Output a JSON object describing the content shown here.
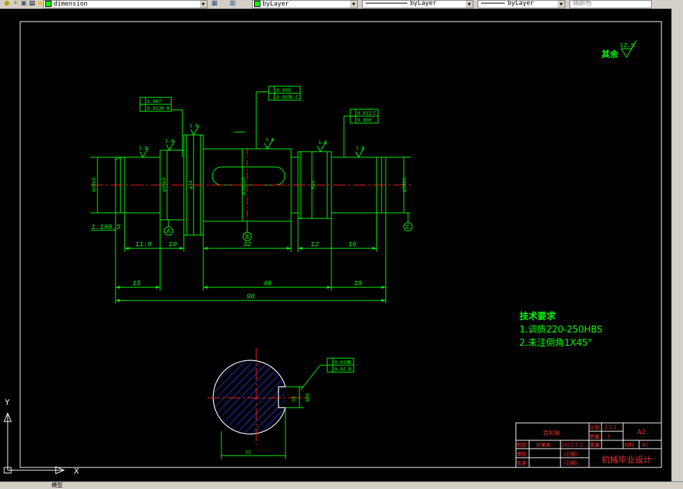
{
  "toolbar": {
    "dimstyle": "dimension",
    "color": "byLayer",
    "linetype": "byLayer",
    "lineweight": "byLayer",
    "plotstyle": "随颜色"
  },
  "roughness": {
    "label": "其余",
    "value": "12.5"
  },
  "notes": {
    "title": "技术要求",
    "line1": "1.调质220-250HBS",
    "line2": "2.未注倒角1X45°"
  },
  "dims": {
    "chamfer": "1.1X0.5",
    "d119": "11.9",
    "d10": "10",
    "d32": "32",
    "d12": "12",
    "d16": "16",
    "d15": "15",
    "d46": "46",
    "d19": "19",
    "d96": "96",
    "keyb": "32",
    "keyw": "8",
    "dbottom": "12"
  },
  "diameters": {
    "left": "φ20k6",
    "d2": "φ26k6",
    "collar": "φ34",
    "mid": "φ30h10",
    "thread": "M24",
    "right": "φ20k6",
    "section": "8N9"
  },
  "finishes": {
    "f1": "1.6",
    "f2": "1.6",
    "f3": "1.6",
    "f4": "1.6",
    "f5": "1.6",
    "f6": "1.6"
  },
  "datums": {
    "a": "A",
    "b": "B",
    "c": "C"
  },
  "tolerances": {
    "t1a": "0.007",
    "t1b": "0.012",
    "t1c": "A-B",
    "t2a": "0.008",
    "t2b": "0.015",
    "t2c": "A-C",
    "t3a": "0.012",
    "t3b": "C",
    "t3c": "0.006",
    "t4a": "0.015",
    "t4b": "B",
    "t4c": "0.02",
    "t4d": "B"
  },
  "titleblock": {
    "part": "齿轮轴",
    "scale_label": "比例",
    "scale": "2.5:1",
    "qty_label": "数量",
    "qty": "1",
    "size": "A2",
    "mat_label": "材料",
    "mat": "45",
    "drawn_label": "制图",
    "drawn_by": "孙某某",
    "date": "2012-5-2",
    "weight_label": "重量",
    "check_label": "审核",
    "check_date": "(日期)",
    "approve_label": "批准",
    "approve_date": "(日期)",
    "school": "机械毕业设计"
  },
  "ucs": {
    "x": "X",
    "y": "Y"
  },
  "status": {
    "tab": "模型"
  },
  "colors": {
    "lines": "#00ff00",
    "center": "#ff2020",
    "hatch": "#2040ff",
    "frame": "#ffffff",
    "title": "#ff3030"
  }
}
